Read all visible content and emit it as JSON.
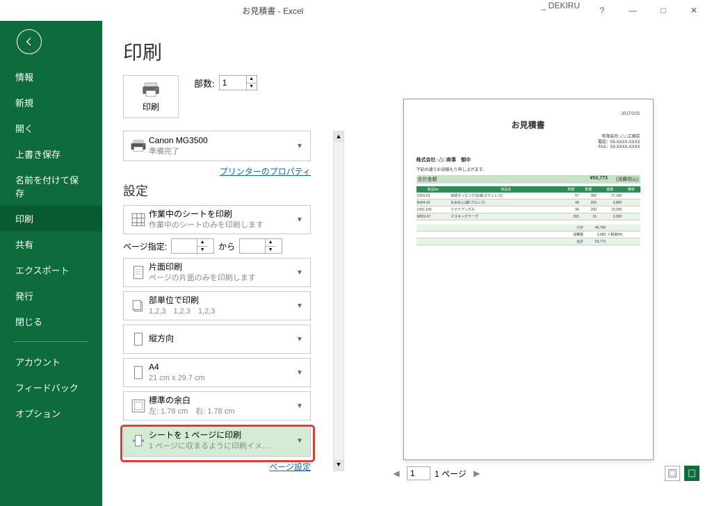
{
  "titlebar": {
    "file": "お見積書",
    "app": "Excel",
    "user": "_ DEKIRU"
  },
  "win": {
    "help": "?",
    "min": "—",
    "max": "□",
    "close": "✕"
  },
  "nav": {
    "items": [
      {
        "key": "info",
        "label": "情報"
      },
      {
        "key": "new",
        "label": "新規"
      },
      {
        "key": "open",
        "label": "開く"
      },
      {
        "key": "save",
        "label": "上書き保存"
      },
      {
        "key": "saveas",
        "label": "名前を付けて保存"
      },
      {
        "key": "print",
        "label": "印刷",
        "active": true
      },
      {
        "key": "share",
        "label": "共有"
      },
      {
        "key": "export",
        "label": "エクスポート"
      },
      {
        "key": "publish",
        "label": "発行"
      },
      {
        "key": "close",
        "label": "閉じる"
      }
    ],
    "items2": [
      {
        "key": "account",
        "label": "アカウント"
      },
      {
        "key": "feedback",
        "label": "フィードバック"
      },
      {
        "key": "options",
        "label": "オプション"
      }
    ]
  },
  "page": {
    "heading": "印刷",
    "print_btn": "印刷",
    "copies_label": "部数:",
    "copies_value": "1",
    "printer": {
      "name": "Canon MG3500",
      "status": "準備完了"
    },
    "printer_props": "プリンターのプロパティ",
    "settings_header": "設定",
    "settings": {
      "scope": {
        "title": "作業中のシートを印刷",
        "sub": "作業中のシートのみを印刷します"
      },
      "range_label": "ページ指定:",
      "range_to": "から",
      "sides": {
        "title": "片面印刷",
        "sub": "ページの片面のみを印刷します"
      },
      "collate": {
        "title": "部単位で印刷",
        "sub": "1,2,3　1,2,3　1,2,3"
      },
      "orient": {
        "title": "縦方向",
        "sub": ""
      },
      "paper": {
        "title": "A4",
        "sub": "21 cm x 29.7 cm"
      },
      "margins": {
        "title": "標準の余白",
        "sub": "左: 1.78 cm　右: 1.78 cm"
      },
      "scale": {
        "title": "シートを 1 ページに印刷",
        "sub": "1 ページに収まるように印刷イメ…"
      }
    },
    "page_setup": "ページ設定",
    "nav": {
      "current": "1",
      "total": "1 ページ",
      "prev": "◀",
      "next": "▶"
    }
  },
  "preview": {
    "date": "2017/2/21",
    "title": "お見積書",
    "company_lines": [
      "有限会社○△□工務店",
      "電話：03-XXXX-XXXX",
      "FAX：03-XXXX-XXXX"
    ],
    "customer": "株式会社○△□商事　御中",
    "lead": "下記の通りお見積もり申し上げます。",
    "total_label": "合計金額",
    "total_value": "¥53,773",
    "total_suffix": "(消費税込)",
    "cols": [
      "商品No",
      "商品名",
      "単価",
      "数量",
      "金額",
      "備考"
    ],
    "rows": [
      [
        "C001-01",
        "皿頭タッピング白(鉄/ステンレス)",
        "57",
        "300",
        "17,100",
        ""
      ],
      [
        "B004-10",
        "丸木ねじ(鉄/ブロンズ)",
        "49",
        "200",
        "9,800",
        ""
      ],
      [
        "L001-100",
        "ワイドアングル",
        "96",
        "200",
        "19,200",
        ""
      ],
      [
        "M002-07",
        "マスキングテープ",
        "393",
        "10",
        "3,930",
        ""
      ]
    ],
    "sub_rows": [
      [
        "小計",
        "49,790"
      ],
      [
        "消費税",
        "3,983"
      ],
      [
        "合計",
        "53,773"
      ]
    ],
    "sub_tax_note": "※税率8%"
  },
  "chart_data": {
    "type": "table",
    "title": "お見積書",
    "columns": [
      "商品No",
      "商品名",
      "単価",
      "数量",
      "金額",
      "備考"
    ],
    "rows": [
      [
        "C001-01",
        "皿頭タッピング白(鉄/ステンレス)",
        57,
        300,
        17100,
        ""
      ],
      [
        "B004-10",
        "丸木ねじ(鉄/ブロンズ)",
        49,
        200,
        9800,
        ""
      ],
      [
        "L001-100",
        "ワイドアングル",
        96,
        200,
        19200,
        ""
      ],
      [
        "M002-07",
        "マスキングテープ",
        393,
        10,
        3930,
        ""
      ]
    ],
    "summary": {
      "小計": 49790,
      "消費税": 3983,
      "合計": 53773
    }
  }
}
